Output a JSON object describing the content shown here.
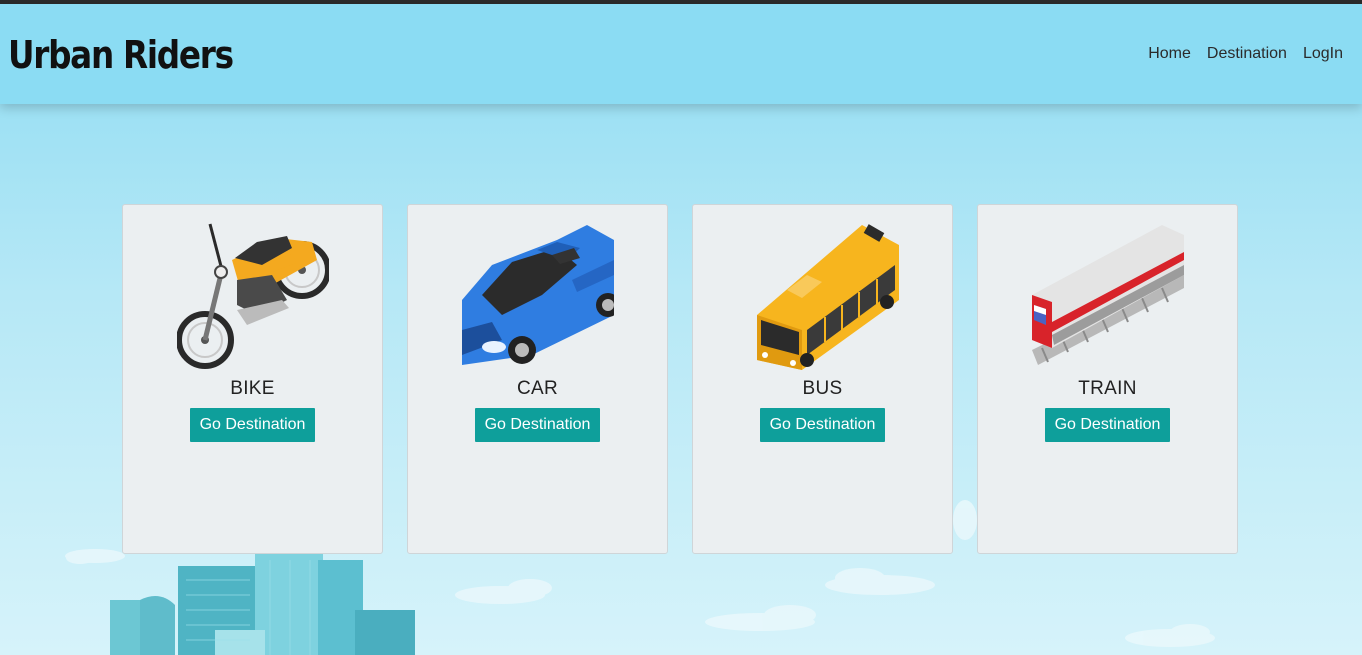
{
  "header": {
    "brand": "Urban Riders",
    "nav": [
      {
        "label": "Home"
      },
      {
        "label": "Destination"
      },
      {
        "label": "LogIn"
      }
    ]
  },
  "vehicles": [
    {
      "title": "BIKE",
      "button": "Go Destination",
      "icon": "motorbike-icon"
    },
    {
      "title": "CAR",
      "button": "Go Destination",
      "icon": "car-icon"
    },
    {
      "title": "BUS",
      "button": "Go Destination",
      "icon": "bus-icon"
    },
    {
      "title": "TRAIN",
      "button": "Go Destination",
      "icon": "train-icon"
    }
  ],
  "colors": {
    "navbar": "#8bdcf3",
    "button": "#0e9f9b",
    "card": "#ebeff1"
  }
}
